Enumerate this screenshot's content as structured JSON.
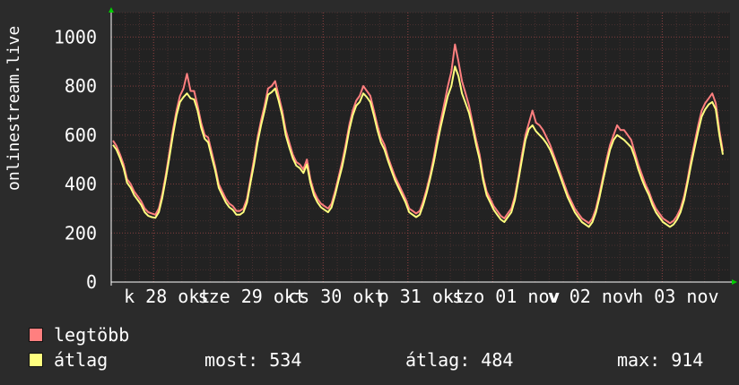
{
  "chart_data": {
    "type": "line",
    "ylabel": "onlinestream.live",
    "ylim": [
      0,
      1100
    ],
    "yticks": [
      0,
      200,
      400,
      600,
      800,
      1000
    ],
    "x_tick_labels": [
      "k 28 okt",
      "sze 29 okt",
      "cs 30 okt",
      "p 31 okt",
      "szo 01 nov",
      "v 02 nov",
      "h 03 nov"
    ],
    "grid": true,
    "colors": {
      "max": "#ff7f7f",
      "avg": "#ffff7f",
      "axis_arrow": "#00cc00"
    },
    "series": [
      {
        "name": "legtöbb",
        "color": "#ff7f7f",
        "values": [
          577,
          555,
          520,
          480,
          420,
          400,
          370,
          350,
          330,
          300,
          285,
          280,
          275,
          300,
          360,
          440,
          530,
          620,
          700,
          760,
          790,
          850,
          780,
          780,
          720,
          650,
          600,
          590,
          530,
          470,
          400,
          370,
          340,
          320,
          310,
          290,
          290,
          300,
          340,
          420,
          500,
          590,
          660,
          720,
          790,
          800,
          820,
          760,
          700,
          620,
          570,
          520,
          490,
          480,
          460,
          500,
          420,
          370,
          340,
          320,
          310,
          300,
          320,
          370,
          430,
          490,
          560,
          640,
          700,
          740,
          760,
          800,
          780,
          760,
          700,
          640,
          590,
          560,
          510,
          470,
          430,
          400,
          370,
          340,
          300,
          290,
          280,
          290,
          330,
          380,
          440,
          510,
          590,
          660,
          730,
          800,
          860,
          970,
          900,
          820,
          770,
          720,
          650,
          580,
          520,
          430,
          370,
          340,
          310,
          290,
          270,
          260,
          280,
          300,
          350,
          430,
          520,
          600,
          650,
          700,
          650,
          640,
          620,
          590,
          560,
          520,
          480,
          440,
          400,
          360,
          330,
          300,
          280,
          260,
          250,
          240,
          260,
          300,
          360,
          430,
          500,
          560,
          600,
          640,
          620,
          620,
          600,
          580,
          530,
          480,
          440,
          400,
          370,
          330,
          300,
          280,
          260,
          250,
          240,
          250,
          270,
          300,
          350,
          420,
          500,
          570,
          640,
          700,
          730,
          750,
          770,
          730,
          620,
          534
        ]
      },
      {
        "name": "átlag",
        "color": "#ffff7f",
        "values": [
          560,
          540,
          505,
          465,
          405,
          385,
          355,
          335,
          315,
          285,
          270,
          265,
          262,
          285,
          345,
          425,
          510,
          600,
          680,
          735,
          755,
          770,
          750,
          745,
          700,
          630,
          585,
          570,
          510,
          455,
          385,
          355,
          325,
          305,
          295,
          275,
          275,
          285,
          325,
          405,
          480,
          570,
          640,
          700,
          765,
          775,
          790,
          740,
          680,
          600,
          550,
          505,
          475,
          465,
          445,
          480,
          405,
          355,
          325,
          305,
          295,
          285,
          305,
          355,
          415,
          470,
          540,
          620,
          680,
          720,
          735,
          770,
          755,
          735,
          680,
          620,
          570,
          540,
          495,
          455,
          415,
          385,
          355,
          325,
          285,
          275,
          265,
          275,
          315,
          365,
          425,
          490,
          565,
          635,
          700,
          760,
          800,
          880,
          840,
          770,
          730,
          690,
          630,
          560,
          500,
          415,
          355,
          325,
          295,
          275,
          255,
          245,
          265,
          285,
          335,
          415,
          500,
          580,
          625,
          640,
          615,
          600,
          585,
          565,
          540,
          505,
          465,
          425,
          385,
          345,
          315,
          285,
          265,
          245,
          235,
          225,
          245,
          285,
          345,
          415,
          480,
          540,
          580,
          600,
          590,
          580,
          565,
          550,
          510,
          460,
          420,
          385,
          355,
          315,
          285,
          265,
          245,
          235,
          225,
          235,
          255,
          285,
          335,
          405,
          480,
          550,
          615,
          675,
          705,
          725,
          735,
          705,
          600,
          520
        ]
      }
    ]
  },
  "legend": [
    {
      "label": "legtöbb",
      "color": "#ff7f7f"
    },
    {
      "label": "átlag",
      "color": "#ffff7f"
    }
  ],
  "stats": {
    "most": "most: 534",
    "atlag": "átlag: 484",
    "max": "max: 914"
  }
}
